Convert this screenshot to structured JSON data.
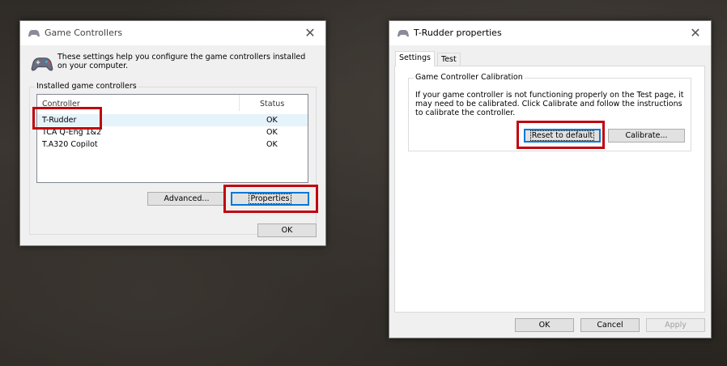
{
  "game_controllers": {
    "title": "Game Controllers",
    "intro": "These settings help you configure the game controllers installed on your computer.",
    "group_label": "Installed game controllers",
    "columns": {
      "controller": "Controller",
      "status": "Status"
    },
    "rows": [
      {
        "name": "T-Rudder",
        "status": "OK"
      },
      {
        "name": "TCA Q-Eng 1&2",
        "status": "OK"
      },
      {
        "name": "T.A320 Copilot",
        "status": "OK"
      }
    ],
    "advanced_label": "Advanced...",
    "properties_label": "Properties",
    "ok_label": "OK"
  },
  "properties": {
    "title": "T-Rudder properties",
    "tabs": [
      "Settings",
      "Test"
    ],
    "group_label": "Game Controller Calibration",
    "description": "If your game controller is not functioning properly on the Test page, it may need to be calibrated. Click Calibrate and follow the instructions to calibrate the controller.",
    "reset_label": "Reset to default",
    "calibrate_label": "Calibrate...",
    "ok_label": "OK",
    "cancel_label": "Cancel",
    "apply_label": "Apply"
  },
  "colors": {
    "highlight": "#c0060f",
    "focus": "#0078d7"
  }
}
